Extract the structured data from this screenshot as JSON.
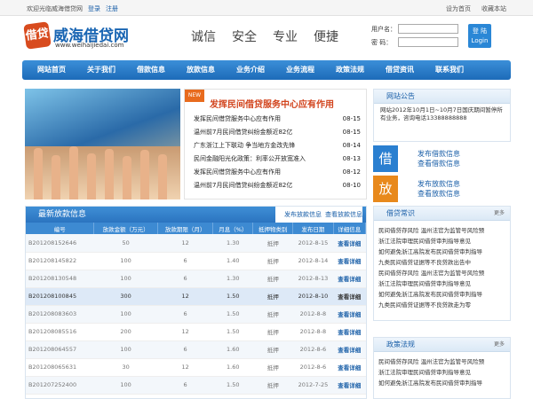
{
  "topbar": {
    "welcome": "欢迎光临威海借贷网",
    "login": "登录",
    "register": "注册",
    "set_home": "设为首页",
    "bookmark": "收藏本站"
  },
  "logo": {
    "mark": "借贷",
    "name": "威海借贷网",
    "url": "www.weihaijiedai.com"
  },
  "slogans": [
    "诚信",
    "安全",
    "专业",
    "便捷"
  ],
  "login": {
    "user_label": "用户名：",
    "pass_label": "密  码：",
    "button_line1": "登 陆",
    "button_line2": "Login"
  },
  "nav": [
    "网站首页",
    "关于我们",
    "借款信息",
    "放款信息",
    "业务介绍",
    "业务流程",
    "政策法规",
    "借贷资讯",
    "联系我们"
  ],
  "news": {
    "badge": "NEW",
    "headline": "发挥民间借贷服务中心应有作用",
    "items": [
      {
        "title": "发挥民间借贷服务中心应有作用",
        "date": "08-15"
      },
      {
        "title": "温州前7月民间借贷纠纷金额近82亿",
        "date": "08-15"
      },
      {
        "title": "广东浙江上下联动 争当地方金改先锋",
        "date": "08-14"
      },
      {
        "title": "民间金融阳光化政策：利率公开放宽准入",
        "date": "08-13"
      },
      {
        "title": "发挥民间借贷服务中心应有作用",
        "date": "08-12"
      },
      {
        "title": "温州前7月民间借贷纠纷金额近82亿",
        "date": "08-10"
      }
    ]
  },
  "notice": {
    "title": "网站公告",
    "body": "网站2012年10月1日~10月7日国庆期间暂停所有业务，咨询电话13388888888"
  },
  "borrow": {
    "icon": "借",
    "line1": "发布借款信息",
    "line2": "查看借款信息",
    "color": "#2a7fd0"
  },
  "lend": {
    "icon": "放",
    "line1": "发布放款信息",
    "line2": "查看放款信息",
    "color": "#e8891c"
  },
  "loans": {
    "title": "最新放款信息",
    "link1": "发布放款信息",
    "link2": "查看放款信息",
    "headers": [
      "编号",
      "放款金额（万元）",
      "放款期限（月）",
      "月息（%）",
      "抵押物类别",
      "发布日期",
      "详细信息"
    ],
    "rows": [
      [
        "B201208152646",
        "50",
        "12",
        "1.30",
        "抵押",
        "2012-8-15",
        "查看详细"
      ],
      [
        "B201208145822",
        "100",
        "6",
        "1.40",
        "抵押",
        "2012-8-14",
        "查看详细"
      ],
      [
        "B201208130548",
        "100",
        "6",
        "1.30",
        "抵押",
        "2012-8-13",
        "查看详细"
      ],
      [
        "B201208100845",
        "300",
        "12",
        "1.50",
        "抵押",
        "2012-8-10",
        "查看详细"
      ],
      [
        "B201208083603",
        "100",
        "6",
        "1.50",
        "抵押",
        "2012-8-8",
        "查看详细"
      ],
      [
        "B201208085516",
        "200",
        "12",
        "1.50",
        "抵押",
        "2012-8-8",
        "查看详细"
      ],
      [
        "B201208064557",
        "100",
        "6",
        "1.60",
        "抵押",
        "2012-8-6",
        "查看详细"
      ],
      [
        "B201208065631",
        "30",
        "12",
        "1.60",
        "抵押",
        "2012-8-6",
        "查看详细"
      ],
      [
        "B201207252400",
        "100",
        "6",
        "1.50",
        "抵押",
        "2012-7-25",
        "查看详细"
      ]
    ]
  },
  "knowledge": {
    "title": "借贷常识",
    "more": "更多",
    "items": [
      "民间借贷存风险 温州法官为监管号风险预",
      "浙江法院审理民间借贷审判指导意见",
      "如何避免浙江高院发布民间借贷审判指导",
      "九类民间借贷证据等不良贷款出告中",
      "民间借贷存风险 温州法官为监管号风险预",
      "浙江法院审理民间借贷审判指导意见",
      "如何避免浙江高院发布民间借贷审判指导",
      "九类民间借贷证据等不良贷款走为零"
    ]
  },
  "policy": {
    "title": "政策法规",
    "more": "更多",
    "items": [
      "民间借贷存风险 温州法官为监管号风险预",
      "浙江法院审理民间借贷审判指导意见",
      "如何避免浙江高院发布民间借贷审判指导"
    ]
  }
}
